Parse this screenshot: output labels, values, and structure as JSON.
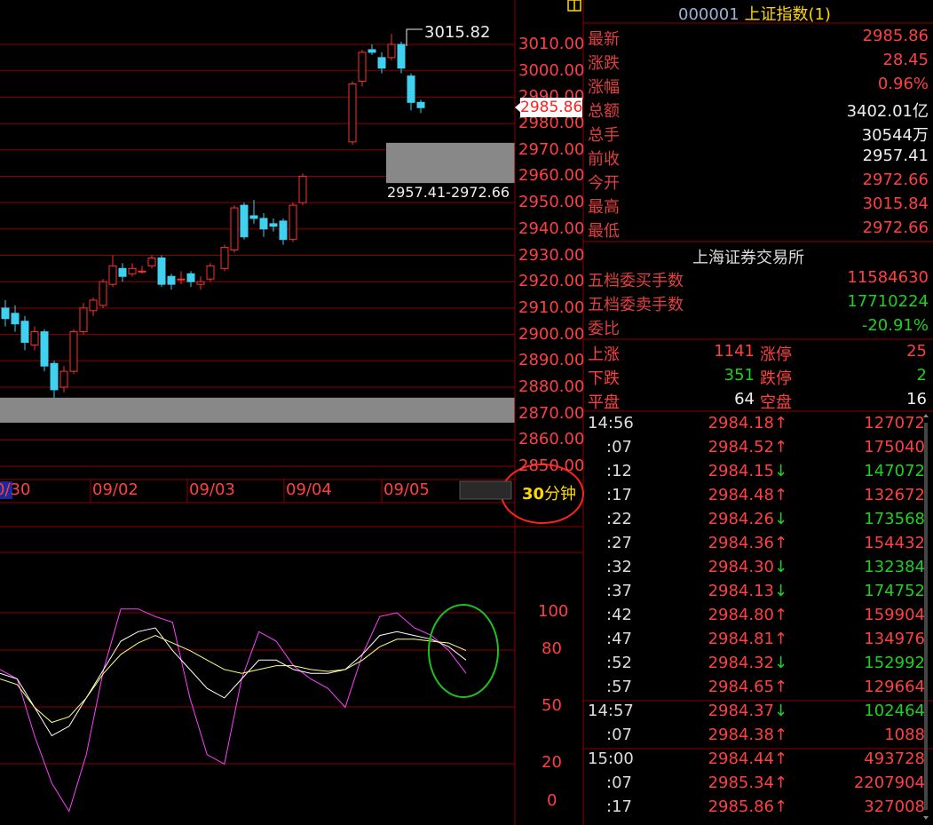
{
  "colors": {
    "up": "#ff3030",
    "down": "#40d0f0",
    "grid": "#8b0000",
    "k_line": "#ffffff",
    "d_line": "#ffff80",
    "j_line": "#ff40ff",
    "zone": "#888888"
  },
  "header": {
    "code": "000001",
    "name": "上证指数",
    "suffix": "(1)"
  },
  "quote": [
    {
      "label": "最新",
      "value": "2985.86",
      "color": "red"
    },
    {
      "label": "涨跌",
      "value": "28.45",
      "color": "red"
    },
    {
      "label": "涨幅",
      "value": "0.96%",
      "color": "red"
    },
    {
      "label": "总额",
      "value": "3402.01亿",
      "color": "white"
    },
    {
      "label": "总手",
      "value": "30544万",
      "color": "white"
    },
    {
      "label": "前收",
      "value": "2957.41",
      "color": "white"
    },
    {
      "label": "今开",
      "value": "2972.66",
      "color": "red"
    },
    {
      "label": "最高",
      "value": "3015.84",
      "color": "red"
    },
    {
      "label": "最低",
      "value": "2972.66",
      "color": "red"
    }
  ],
  "exchange": "上海证券交易所",
  "orders": [
    {
      "label": "五档委买手数",
      "value": "11584630",
      "color": "red"
    },
    {
      "label": "五档委卖手数",
      "value": "17710224",
      "color": "green"
    },
    {
      "label": "委比",
      "value": "-20.91%",
      "color": "green"
    }
  ],
  "breadth": {
    "up_label": "上涨",
    "up": "1141",
    "limit_up_label": "涨停",
    "limit_up": "25",
    "down_label": "下跌",
    "down": "351",
    "limit_down_label": "跌停",
    "limit_down": "2",
    "flat_label": "平盘",
    "flat": "64",
    "empty_label": "空盘",
    "empty": "16"
  },
  "ticks": [
    {
      "time": "14:56",
      "price": "2984.18",
      "dir": "↑",
      "vol": "127072",
      "vcolor": "red"
    },
    {
      "time": ":07",
      "price": "2984.52",
      "dir": "↑",
      "vol": "175040",
      "vcolor": "red"
    },
    {
      "time": ":12",
      "price": "2984.15",
      "dir": "↓",
      "vol": "147072",
      "vcolor": "green"
    },
    {
      "time": ":17",
      "price": "2984.48",
      "dir": "↑",
      "vol": "132672",
      "vcolor": "red"
    },
    {
      "time": ":22",
      "price": "2984.26",
      "dir": "↓",
      "vol": "173568",
      "vcolor": "green"
    },
    {
      "time": ":27",
      "price": "2984.36",
      "dir": "↑",
      "vol": "154432",
      "vcolor": "red"
    },
    {
      "time": ":32",
      "price": "2984.30",
      "dir": "↓",
      "vol": "132384",
      "vcolor": "green"
    },
    {
      "time": ":37",
      "price": "2984.13",
      "dir": "↓",
      "vol": "174752",
      "vcolor": "green"
    },
    {
      "time": ":42",
      "price": "2984.80",
      "dir": "↑",
      "vol": "159904",
      "vcolor": "red"
    },
    {
      "time": ":47",
      "price": "2984.81",
      "dir": "↑",
      "vol": "134976",
      "vcolor": "red"
    },
    {
      "time": ":52",
      "price": "2984.32",
      "dir": "↓",
      "vol": "152992",
      "vcolor": "green"
    },
    {
      "time": ":57",
      "price": "2984.65",
      "dir": "↑",
      "vol": "129664",
      "vcolor": "red"
    },
    {
      "time": "14:57",
      "price": "2984.37",
      "dir": "↓",
      "vol": "102464",
      "vcolor": "green"
    },
    {
      "time": ":07",
      "price": "2984.38",
      "dir": "↑",
      "vol": "1088",
      "vcolor": "red"
    },
    {
      "time": "15:00",
      "price": "2984.44",
      "dir": "↑",
      "vol": "493728",
      "vcolor": "red"
    },
    {
      "time": ":07",
      "price": "2985.34",
      "dir": "↑",
      "vol": "2207904",
      "vcolor": "red"
    },
    {
      "time": ":17",
      "price": "2985.86",
      "dir": "↑",
      "vol": "327008",
      "vcolor": "red"
    }
  ],
  "period_button": {
    "number": "30",
    "unit": "分钟"
  },
  "chart_data": [
    {
      "type": "candlestick",
      "yticks": [
        3010,
        3000,
        2990,
        2980,
        2970,
        2960,
        2950,
        2940,
        2930,
        2920,
        2910,
        2900,
        2890,
        2880,
        2870,
        2860,
        2850
      ],
      "ylim": [
        2850,
        3015
      ],
      "date_labels": [
        "0/30",
        "09/02",
        "09/03",
        "09/04",
        "09/05"
      ],
      "last_price_label": "2985.86",
      "high_annotation": "3015.82",
      "gap_zone_label": "2957.41-2972.66",
      "gap_zones": [
        [
          2957.41,
          2972.66
        ],
        [
          2866.5,
          2876
        ]
      ],
      "candles": [
        {
          "o": 2910,
          "c": 2906,
          "h": 2913,
          "l": 2903
        },
        {
          "o": 2908,
          "c": 2904,
          "h": 2911,
          "l": 2901
        },
        {
          "o": 2905,
          "c": 2897,
          "h": 2907,
          "l": 2894
        },
        {
          "o": 2896,
          "c": 2901,
          "h": 2903,
          "l": 2894
        },
        {
          "o": 2901,
          "c": 2888,
          "h": 2902,
          "l": 2886
        },
        {
          "o": 2889,
          "c": 2879,
          "h": 2890,
          "l": 2876
        },
        {
          "o": 2880,
          "c": 2886,
          "h": 2888,
          "l": 2878
        },
        {
          "o": 2886,
          "c": 2901,
          "h": 2902,
          "l": 2885
        },
        {
          "o": 2901,
          "c": 2910,
          "h": 2912,
          "l": 2900
        },
        {
          "o": 2909,
          "c": 2913,
          "h": 2914,
          "l": 2907
        },
        {
          "o": 2911,
          "c": 2920,
          "h": 2921,
          "l": 2910
        },
        {
          "o": 2919,
          "c": 2926,
          "h": 2930,
          "l": 2918
        },
        {
          "o": 2925,
          "c": 2922,
          "h": 2927,
          "l": 2920
        },
        {
          "o": 2923,
          "c": 2925,
          "h": 2927,
          "l": 2922
        },
        {
          "o": 2924,
          "c": 2924,
          "h": 2926,
          "l": 2923
        },
        {
          "o": 2926,
          "c": 2929,
          "h": 2930,
          "l": 2925
        },
        {
          "o": 2929,
          "c": 2919,
          "h": 2930,
          "l": 2918
        },
        {
          "o": 2922,
          "c": 2919,
          "h": 2923,
          "l": 2917
        },
        {
          "o": 2921,
          "c": 2921,
          "h": 2924,
          "l": 2919
        },
        {
          "o": 2923,
          "c": 2920,
          "h": 2924,
          "l": 2918
        },
        {
          "o": 2919,
          "c": 2920,
          "h": 2922,
          "l": 2917
        },
        {
          "o": 2921,
          "c": 2926,
          "h": 2927,
          "l": 2920
        },
        {
          "o": 2925,
          "c": 2933,
          "h": 2934,
          "l": 2924
        },
        {
          "o": 2932,
          "c": 2948,
          "h": 2949,
          "l": 2931
        },
        {
          "o": 2949,
          "c": 2937,
          "h": 2950,
          "l": 2936
        },
        {
          "o": 2945,
          "c": 2944,
          "h": 2951,
          "l": 2942
        },
        {
          "o": 2944,
          "c": 2940,
          "h": 2946,
          "l": 2937
        },
        {
          "o": 2942,
          "c": 2941,
          "h": 2944,
          "l": 2939
        },
        {
          "o": 2943,
          "c": 2936,
          "h": 2944,
          "l": 2934
        },
        {
          "o": 2936,
          "c": 2949,
          "h": 2950,
          "l": 2935
        },
        {
          "o": 2950,
          "c": 2960,
          "h": 2961,
          "l": 2949
        },
        {
          "o": 2973,
          "c": 2995,
          "h": 2996,
          "l": 2972
        },
        {
          "o": 2996,
          "c": 3007,
          "h": 3008,
          "l": 2994
        },
        {
          "o": 3008,
          "c": 3007,
          "h": 3010,
          "l": 3006
        },
        {
          "o": 3005,
          "c": 3001,
          "h": 3007,
          "l": 2999
        },
        {
          "o": 3005,
          "c": 3010,
          "h": 3014,
          "l": 3004
        },
        {
          "o": 3010,
          "c": 3001,
          "h": 3011,
          "l": 2999
        },
        {
          "o": 2998,
          "c": 2988,
          "h": 2999,
          "l": 2985
        },
        {
          "o": 2988,
          "c": 2986,
          "h": 2989,
          "l": 2984
        }
      ]
    },
    {
      "type": "line",
      "yticks": [
        100,
        80,
        50,
        20,
        0
      ],
      "ylim": [
        0,
        100
      ],
      "series": [
        {
          "color": "#ff40ff",
          "values": [
            70,
            65,
            35,
            10,
            -5,
            25,
            70,
            102,
            102,
            98,
            95,
            55,
            25,
            20,
            65,
            90,
            85,
            72,
            65,
            60,
            50,
            78,
            98,
            100,
            92,
            88,
            80,
            68
          ]
        },
        {
          "color": "#ffffff",
          "values": [
            68,
            65,
            50,
            35,
            40,
            55,
            70,
            85,
            90,
            92,
            80,
            70,
            60,
            55,
            65,
            75,
            75,
            70,
            68,
            68,
            70,
            78,
            88,
            90,
            88,
            86,
            82,
            75
          ]
        },
        {
          "color": "#ffff80",
          "values": [
            65,
            62,
            50,
            42,
            45,
            55,
            68,
            78,
            84,
            88,
            84,
            80,
            75,
            70,
            68,
            70,
            72,
            72,
            70,
            69,
            70,
            75,
            82,
            86,
            86,
            85,
            84,
            80
          ]
        }
      ]
    }
  ]
}
